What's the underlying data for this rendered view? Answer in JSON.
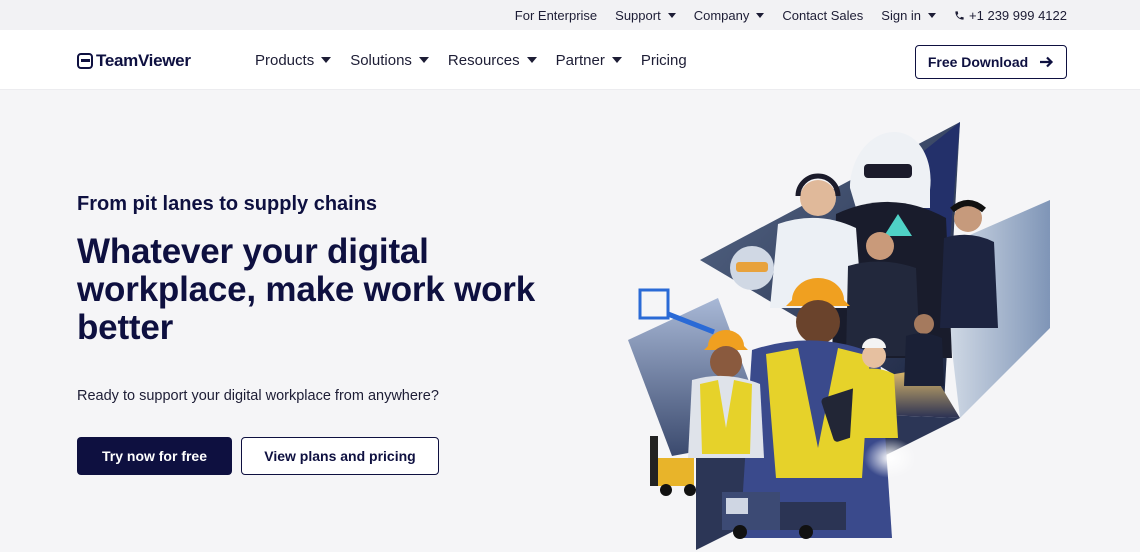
{
  "topbar": {
    "items": [
      {
        "label": "For Enterprise",
        "dropdown": false
      },
      {
        "label": "Support",
        "dropdown": true
      },
      {
        "label": "Company",
        "dropdown": true
      },
      {
        "label": "Contact Sales",
        "dropdown": false
      },
      {
        "label": "Sign in",
        "dropdown": true
      }
    ],
    "phone": "+1 239 999 4122"
  },
  "nav": {
    "logo": "TeamViewer",
    "links": [
      {
        "label": "Products",
        "dropdown": true
      },
      {
        "label": "Solutions",
        "dropdown": true
      },
      {
        "label": "Resources",
        "dropdown": true
      },
      {
        "label": "Partner",
        "dropdown": true
      },
      {
        "label": "Pricing",
        "dropdown": false
      }
    ],
    "cta": "Free Download"
  },
  "hero": {
    "eyebrow": "From pit lanes to supply chains",
    "headline": "Whatever your digital workplace, make work work better",
    "subtext": "Ready to support your digital workplace from anywhere?",
    "primary_cta": "Try now for free",
    "secondary_cta": "View plans and pricing"
  },
  "colors": {
    "brand_navy": "#0e1040",
    "background": "#f5f5f7",
    "topbar_bg": "#f2f2f4",
    "accent_blue": "#2a6ad6",
    "safety_yellow": "#e6d22a",
    "helmet_orange": "#f0a020"
  },
  "icons": {
    "phone": "phone-icon",
    "arrow": "arrow-right-icon",
    "caret": "caret-down-icon",
    "logo": "teamviewer-logo-icon"
  }
}
